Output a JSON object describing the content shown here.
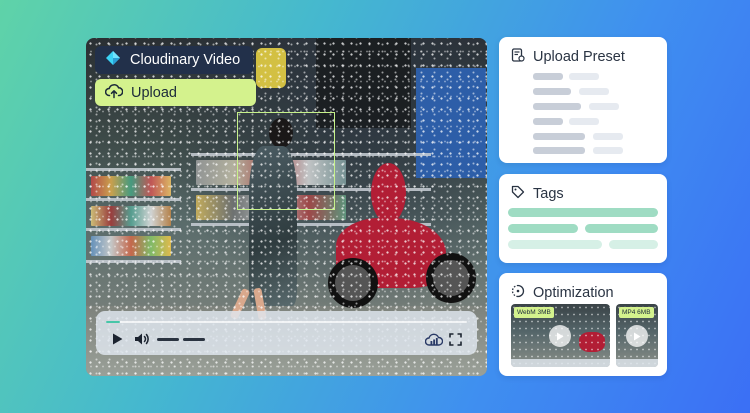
{
  "video": {
    "brand_label": "Cloudinary Video",
    "upload_label": "Upload",
    "playback_progress": 0.04
  },
  "cards": {
    "upload_preset": {
      "title": "Upload Preset"
    },
    "tags": {
      "title": "Tags"
    },
    "optimization": {
      "title": "Optimization",
      "thumbnails": [
        {
          "badge": "WebM 3MB"
        },
        {
          "badge": "MP4 6MB"
        }
      ]
    }
  },
  "colors": {
    "brand_pill": "#22304a",
    "upload_pill": "#d4f28d",
    "detect_box": "#c6f28a",
    "progress": "#47c6a8",
    "tag_bar": "#9fdcc3"
  },
  "icons": {
    "brand": "cloudinary-diamond-icon",
    "upload": "cloud-upload-icon",
    "play": "play-icon",
    "volume": "volume-icon",
    "cloud_quality": "cloud-quality-icon",
    "fullscreen": "fullscreen-icon",
    "preset": "preset-icon",
    "tag": "tag-icon",
    "optimization": "optimization-icon"
  }
}
